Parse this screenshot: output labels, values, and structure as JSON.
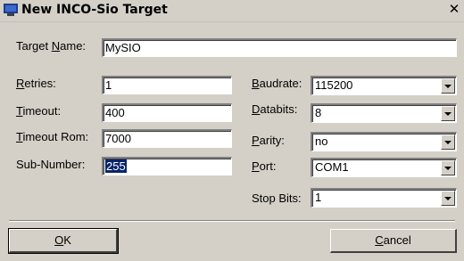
{
  "window": {
    "title": "New INCO-Sio Target",
    "close_glyph": "✕"
  },
  "target_name": {
    "label_pre": "Target ",
    "label_ul": "N",
    "label_post": "ame:",
    "value": "MySIO"
  },
  "retries": {
    "label_ul": "R",
    "label_post": "etries:",
    "value": "1"
  },
  "timeout": {
    "label_ul": "T",
    "label_post": "imeout:",
    "value": "400"
  },
  "timeout_rom": {
    "label_ul": "T",
    "label_post": "imeout Rom:",
    "value": "7000"
  },
  "sub_number": {
    "label": "Sub-Number:",
    "value": "255"
  },
  "baudrate": {
    "label_ul": "B",
    "label_post": "audrate:",
    "value": "115200"
  },
  "databits": {
    "label_ul": "D",
    "label_post": "atabits:",
    "value": "8"
  },
  "parity": {
    "label_ul": "P",
    "label_post": "arity:",
    "value": "no"
  },
  "port": {
    "label_ul": "P",
    "label_post": "ort:",
    "value": "COM1"
  },
  "stop_bits": {
    "label": "Stop Bits:",
    "value": "1"
  },
  "buttons": {
    "ok": {
      "ul": "O",
      "post": "K"
    },
    "cancel": {
      "ul": "C",
      "post": "ancel"
    }
  }
}
